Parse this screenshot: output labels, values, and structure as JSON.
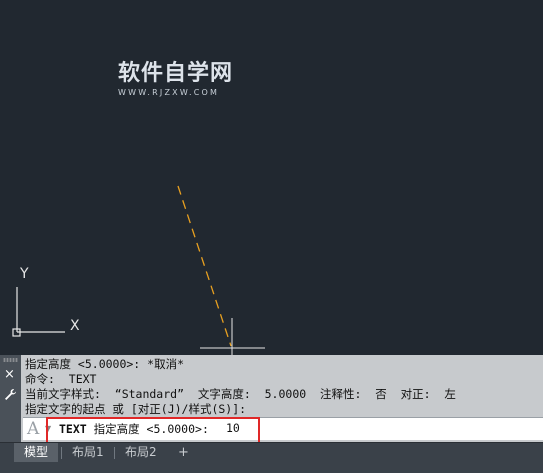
{
  "watermark": {
    "title": "软件自学网",
    "url": "WWW.RJZXW.COM"
  },
  "ucs": {
    "y_label": "Y",
    "x_label": "X"
  },
  "command_line": {
    "handle": {
      "close_icon": "×",
      "settings_icon": "wrench"
    },
    "history": [
      "指定高度 <5.0000>: *取消*",
      "命令:  TEXT",
      "当前文字样式:  “Standard”  文字高度:  5.0000  注释性:  否  对正:  左",
      "指定文字的起点 或 [对正(J)/样式(S)]:"
    ],
    "input": {
      "icon": "A",
      "command": "TEXT",
      "prompt": " 指定高度 <5.0000>:",
      "value": "10"
    }
  },
  "tabs": {
    "items": [
      "模型",
      "布局1",
      "布局2"
    ],
    "active": 0,
    "add_label": "+"
  },
  "colors": {
    "canvas_bg": "#212830",
    "cad_line": "#e8a020",
    "crosshair": "#e6e6e6",
    "highlight": "#e02828",
    "command_bg": "#c7cacd"
  }
}
